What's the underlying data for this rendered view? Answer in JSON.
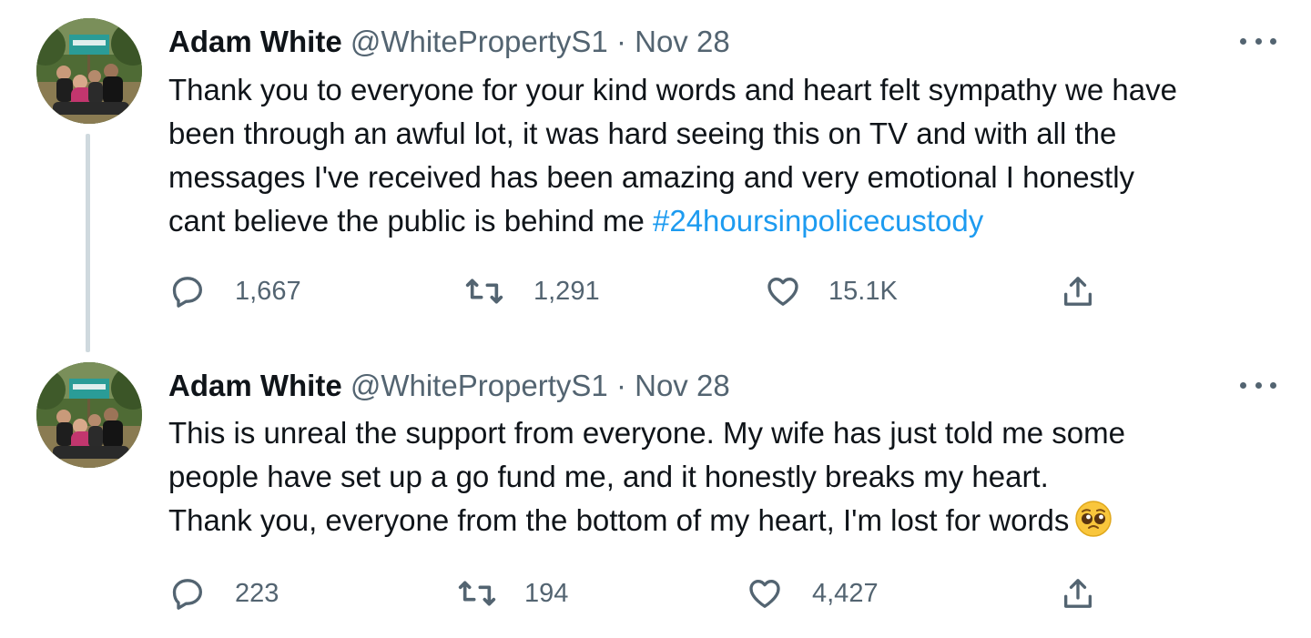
{
  "tweets": [
    {
      "author": {
        "name": "Adam White",
        "handle": "@WhitePropertyS1"
      },
      "separator": "·",
      "date": "Nov 28",
      "text_lines": [
        "Thank you to everyone for your kind words and heart felt sympathy we have",
        "been through an awful lot, it was hard seeing this on TV and with all the",
        "messages I've received has been amazing and very emotional I honestly",
        "cant believe the public is behind me "
      ],
      "hashtag": "#24hoursinpolicecustody",
      "stats": {
        "replies": "1,667",
        "retweets": "1,291",
        "likes": "15.1K"
      },
      "emoji": null
    },
    {
      "author": {
        "name": "Adam White",
        "handle": "@WhitePropertyS1"
      },
      "separator": "·",
      "date": "Nov 28",
      "text_lines": [
        "This is unreal the support from everyone. My wife has just told me some",
        "people have set up a go fund me, and it honestly breaks my heart.",
        "Thank you, everyone from the bottom of my heart, I'm lost for words"
      ],
      "hashtag": "",
      "stats": {
        "replies": "223",
        "retweets": "194",
        "likes": "4,427"
      },
      "emoji": "pleading-face-emoji"
    }
  ],
  "icons": {
    "reply": "reply-icon",
    "retweet": "retweet-icon",
    "like": "heart-icon",
    "share": "share-icon",
    "more": "more-icon"
  },
  "colors": {
    "text": "#0f1419",
    "secondary": "#536471",
    "link": "#1d9bf0",
    "thread_line": "#cfd9de"
  }
}
